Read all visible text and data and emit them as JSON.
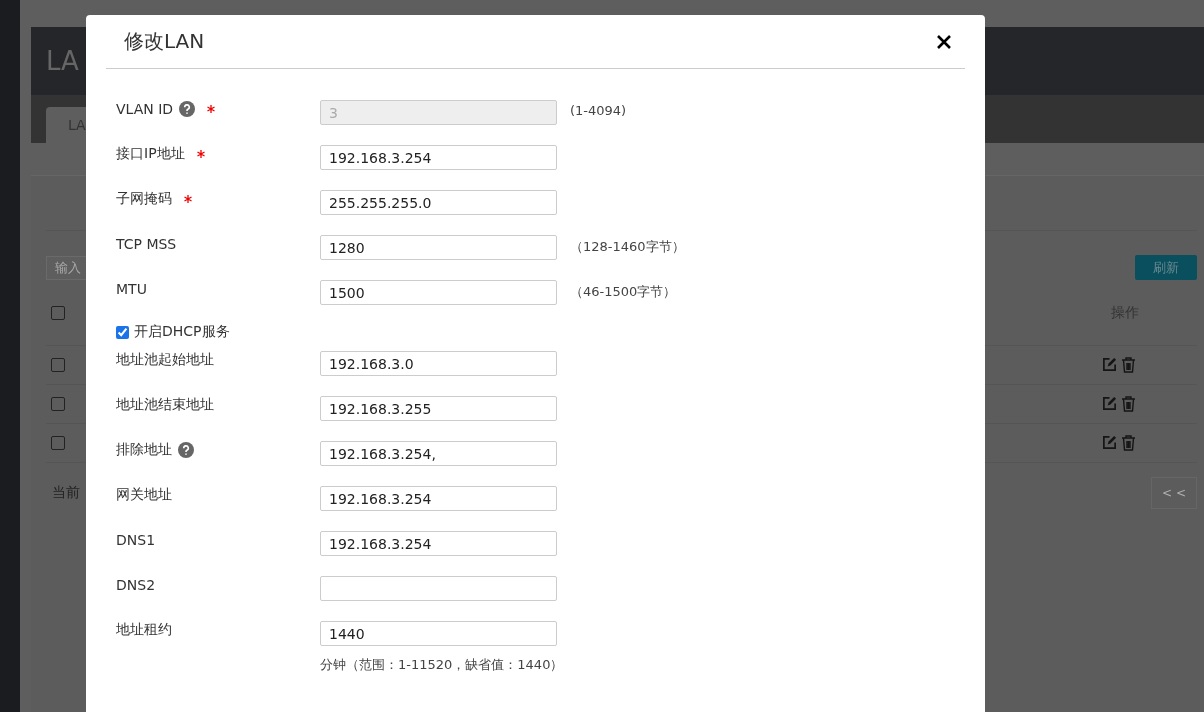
{
  "background": {
    "header_title": "LA",
    "tab": {
      "label": "LA",
      "selected": true
    },
    "search": {
      "placeholder": "输入"
    },
    "refresh_button": "刷新",
    "table": {
      "action_header": "操作",
      "header_checked": false,
      "rows": [
        {
          "checked": false
        },
        {
          "checked": false
        },
        {
          "checked": false
        }
      ]
    },
    "footer_text": "当前",
    "pager_first": "< <"
  },
  "dialog": {
    "title": "修改LAN",
    "fields": [
      {
        "kind": "input",
        "label": "VLAN ID",
        "help": true,
        "required": true,
        "value": "3",
        "disabled": true,
        "hint": "(1-4094)"
      },
      {
        "kind": "input",
        "label": "接口IP地址",
        "help": false,
        "required": true,
        "value": "192.168.3.254",
        "disabled": false
      },
      {
        "kind": "input",
        "label": "子网掩码",
        "help": false,
        "required": true,
        "value": "255.255.255.0",
        "disabled": false
      },
      {
        "kind": "input",
        "label": "TCP MSS",
        "help": false,
        "required": false,
        "value": "1280",
        "disabled": false,
        "hint": "（128-1460字节）"
      },
      {
        "kind": "input",
        "label": "MTU",
        "help": false,
        "required": false,
        "value": "1500",
        "disabled": false,
        "hint": "（46-1500字节）"
      },
      {
        "kind": "checkbox",
        "label": "开启DHCP服务",
        "checked": true
      },
      {
        "kind": "input",
        "label": "地址池起始地址",
        "help": false,
        "required": false,
        "value": "192.168.3.0",
        "disabled": false
      },
      {
        "kind": "input",
        "label": "地址池结束地址",
        "help": false,
        "required": false,
        "value": "192.168.3.255",
        "disabled": false
      },
      {
        "kind": "input",
        "label": "排除地址",
        "help": true,
        "required": false,
        "value": "192.168.3.254,",
        "disabled": false
      },
      {
        "kind": "input",
        "label": "网关地址",
        "help": false,
        "required": false,
        "value": "192.168.3.254",
        "disabled": false
      },
      {
        "kind": "input",
        "label": "DNS1",
        "help": false,
        "required": false,
        "value": "192.168.3.254",
        "disabled": false
      },
      {
        "kind": "input",
        "label": "DNS2",
        "help": false,
        "required": false,
        "disabled": false
      },
      {
        "kind": "input",
        "label": "地址租约",
        "help": false,
        "required": false,
        "value": "1440",
        "disabled": false,
        "note": "分钟（范围：1-11520，缺省值：1440）"
      }
    ]
  }
}
